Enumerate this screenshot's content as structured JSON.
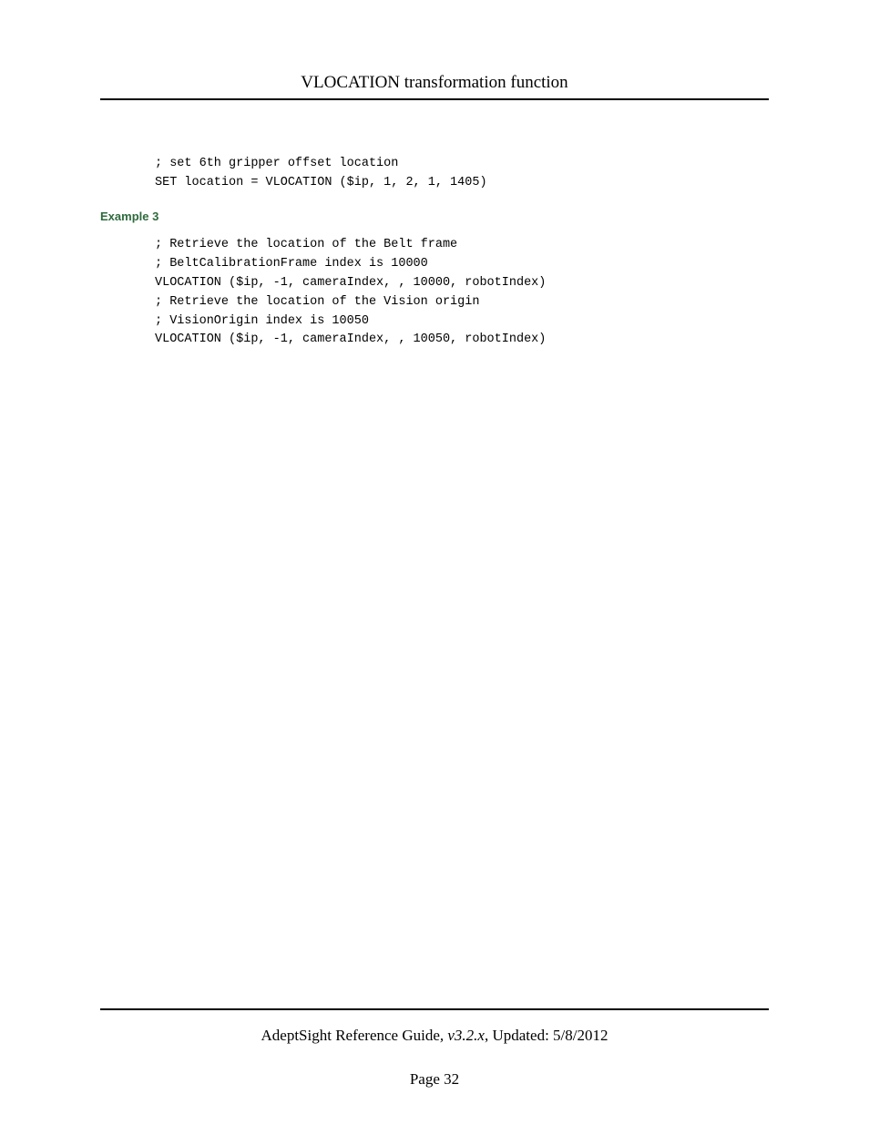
{
  "header": {
    "title": "VLOCATION transformation function"
  },
  "content": {
    "code1_line1": "; set 6th gripper offset location",
    "code1_line2": "SET location = VLOCATION ($ip, 1, 2, 1, 1405)",
    "example3_heading": "Example 3",
    "code2_line1": "; Retrieve the location of the Belt frame",
    "code2_line2": "; BeltCalibrationFrame index is 10000",
    "code2_line3": "VLOCATION ($ip, -1, cameraIndex, , 10000, robotIndex)",
    "code2_line4": "; Retrieve the location of the Vision origin",
    "code2_line5": "; VisionOrigin index is 10050",
    "code2_line6": "VLOCATION ($ip, -1, cameraIndex, , 10050, robotIndex)"
  },
  "footer": {
    "guide_prefix": "AdeptSight Reference Guide",
    "version": ", v3.2.x",
    "updated": ", Updated: 5/8/2012",
    "page_label": "Page 32"
  }
}
